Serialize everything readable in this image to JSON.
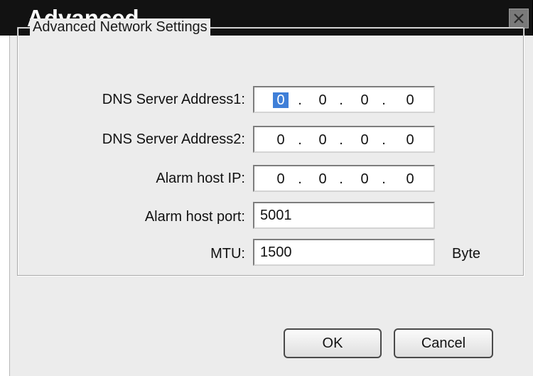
{
  "window": {
    "title": "Advanced",
    "close_icon": "close-icon"
  },
  "group": {
    "title": "Advanced Network Settings"
  },
  "fields": {
    "dns1": {
      "label": "DNS Server Address1:",
      "octets": [
        "0",
        "0",
        "0",
        "0"
      ]
    },
    "dns2": {
      "label": "DNS Server Address2:",
      "octets": [
        "0",
        "0",
        "0",
        "0"
      ]
    },
    "alarm_ip": {
      "label": "Alarm host IP:",
      "octets": [
        "0",
        "0",
        "0",
        "0"
      ]
    },
    "alarm_port": {
      "label": "Alarm host port:",
      "value": "5001"
    },
    "mtu": {
      "label": "MTU:",
      "value": "1500",
      "unit": "Byte"
    }
  },
  "ip_separator": ".",
  "buttons": {
    "ok": "OK",
    "cancel": "Cancel"
  },
  "colors": {
    "titlebar": "#121212",
    "body": "#ececec",
    "selection": "#3f7fd8"
  }
}
